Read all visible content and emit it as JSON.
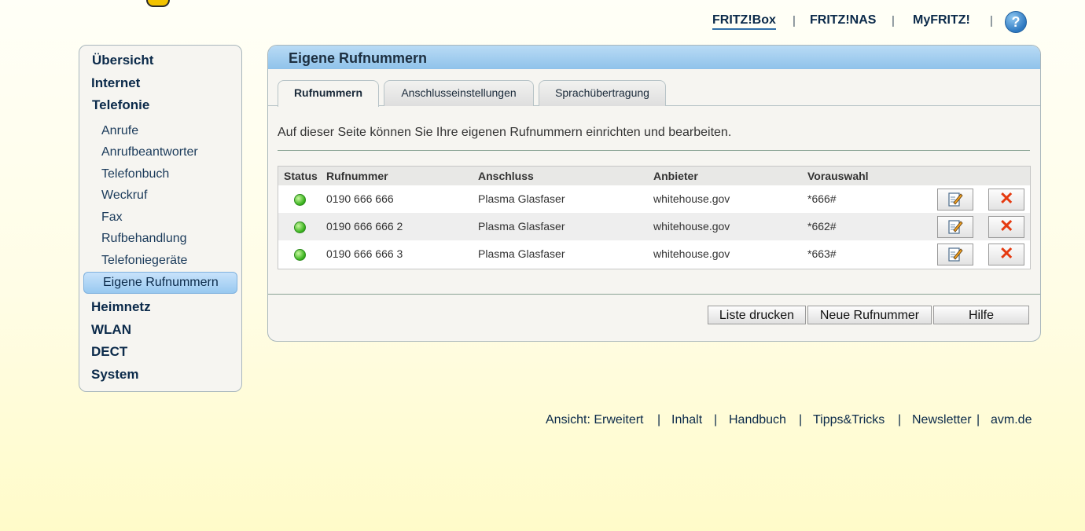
{
  "topnav": {
    "items": [
      "FRITZ!Box",
      "FRITZ!NAS",
      "MyFRITZ!"
    ],
    "separator": "|",
    "help_glyph": "?"
  },
  "sidebar": {
    "items": [
      {
        "label": "Übersicht"
      },
      {
        "label": "Internet"
      },
      {
        "label": "Telefonie"
      },
      {
        "label": "Anrufe"
      },
      {
        "label": "Anrufbeantworter"
      },
      {
        "label": "Telefonbuch"
      },
      {
        "label": "Weckruf"
      },
      {
        "label": "Fax"
      },
      {
        "label": "Rufbehandlung"
      },
      {
        "label": "Telefoniegeräte"
      },
      {
        "label": "Eigene Rufnummern"
      },
      {
        "label": "Heimnetz"
      },
      {
        "label": "WLAN"
      },
      {
        "label": "DECT"
      },
      {
        "label": "System"
      }
    ]
  },
  "panel": {
    "title": "Eigene Rufnummern",
    "tabs": [
      {
        "label": "Rufnummern"
      },
      {
        "label": "Anschlusseinstellungen"
      },
      {
        "label": "Sprachübertragung"
      }
    ],
    "intro": "Auf dieser Seite können Sie Ihre eigenen Rufnummern einrichten und bearbeiten.",
    "table": {
      "headers": [
        "Status",
        "Rufnummer",
        "Anschluss",
        "Anbieter",
        "Vorauswahl"
      ],
      "rows": [
        {
          "number": "0190 666 666",
          "line": "Plasma Glasfaser",
          "provider": "whitehouse.gov",
          "preselect": "*666#"
        },
        {
          "number": "0190 666 666 2",
          "line": "Plasma Glasfaser",
          "provider": "whitehouse.gov",
          "preselect": "*662#"
        },
        {
          "number": "0190 666 666 3",
          "line": "Plasma Glasfaser",
          "provider": "whitehouse.gov",
          "preselect": "*663#"
        }
      ],
      "delete_glyph": "✕"
    },
    "buttons": {
      "print": "Liste drucken",
      "new": "Neue Rufnummer",
      "help": "Hilfe"
    }
  },
  "footer": {
    "items": [
      "Ansicht: Erweitert",
      "Inhalt",
      "Handbuch",
      "Tipps&Tricks",
      "Newsletter",
      "avm.de"
    ],
    "separator": "|"
  },
  "colors": {
    "accent": "#8fc2ea",
    "status_ok": "#3cb520",
    "delete": "#e53a10"
  }
}
